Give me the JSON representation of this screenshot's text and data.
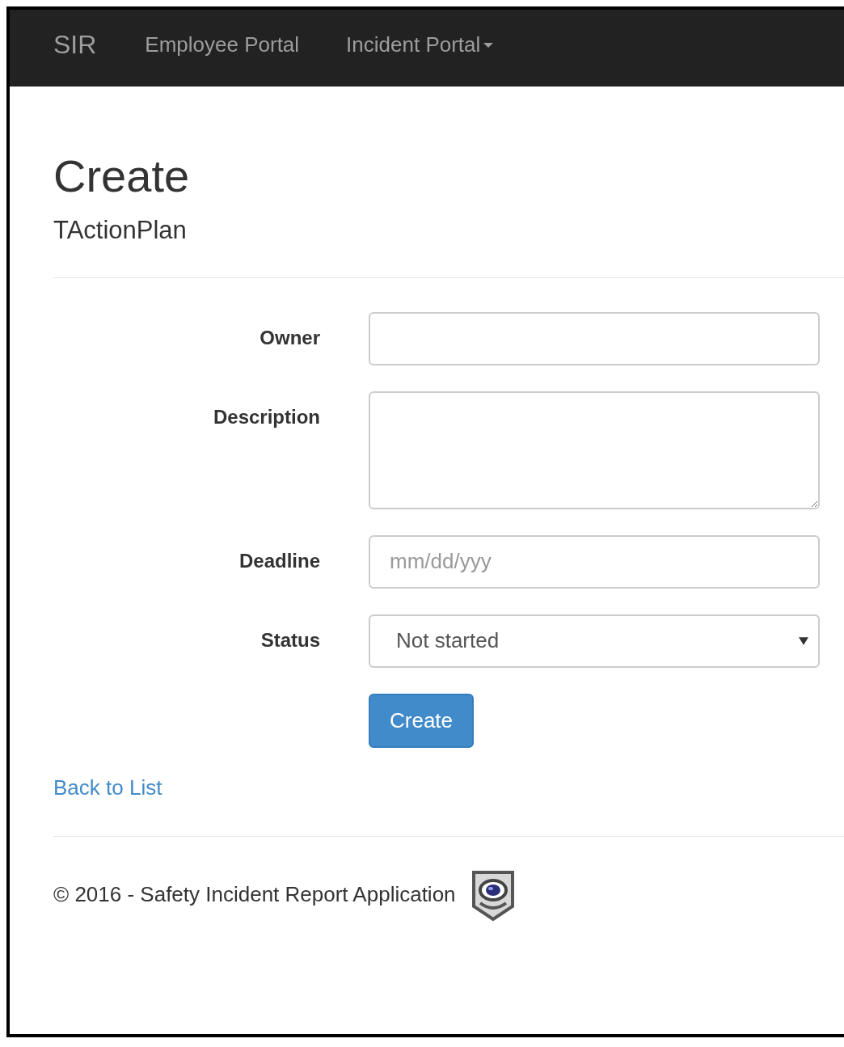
{
  "navbar": {
    "brand": "SIR",
    "items": [
      {
        "label": "Employee Portal",
        "dropdown": false
      },
      {
        "label": "Incident Portal",
        "dropdown": true
      }
    ]
  },
  "page": {
    "title": "Create",
    "subtitle": "TActionPlan"
  },
  "form": {
    "fields": [
      {
        "label": "Owner",
        "kind": "text"
      },
      {
        "label": "Description",
        "kind": "textarea"
      },
      {
        "label": "Deadline",
        "kind": "date",
        "placeholder": "mm/dd/yyy"
      },
      {
        "label": "Status",
        "kind": "select",
        "value": "Not started"
      }
    ],
    "submit": "Create"
  },
  "back_link": "Back to List",
  "footer": {
    "text": "© 2016 - Safety Incident Report Application"
  }
}
